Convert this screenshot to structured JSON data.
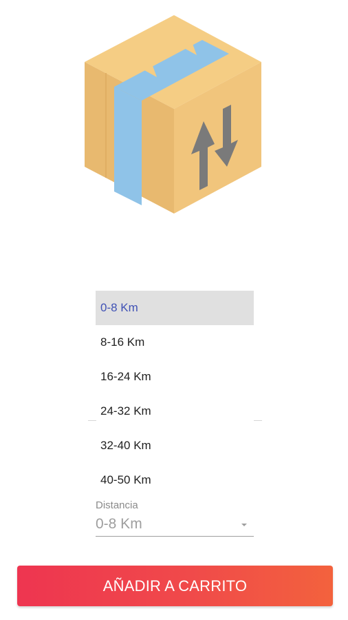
{
  "illustration": {
    "icon": "package-box-arrows-icon",
    "colors": {
      "box_light": "#f5cd84",
      "box_dark": "#e6b66e",
      "tape": "#8fc3e8",
      "arrows": "#7a7a7a"
    }
  },
  "distance_dropdown": {
    "options": [
      {
        "label": "0-8 Km",
        "selected": true
      },
      {
        "label": "8-16 Km",
        "selected": false
      },
      {
        "label": "16-24 Km",
        "selected": false
      },
      {
        "label": "24-32 Km",
        "selected": false
      },
      {
        "label": "32-40 Km",
        "selected": false
      },
      {
        "label": "40-50 Km",
        "selected": false
      }
    ]
  },
  "distance_field": {
    "label": "Distancia",
    "value": "0-8 Km"
  },
  "cart_button": {
    "label": "AÑADIR A CARRITO",
    "colors": {
      "start": "#ee3550",
      "end": "#f3623d"
    }
  }
}
